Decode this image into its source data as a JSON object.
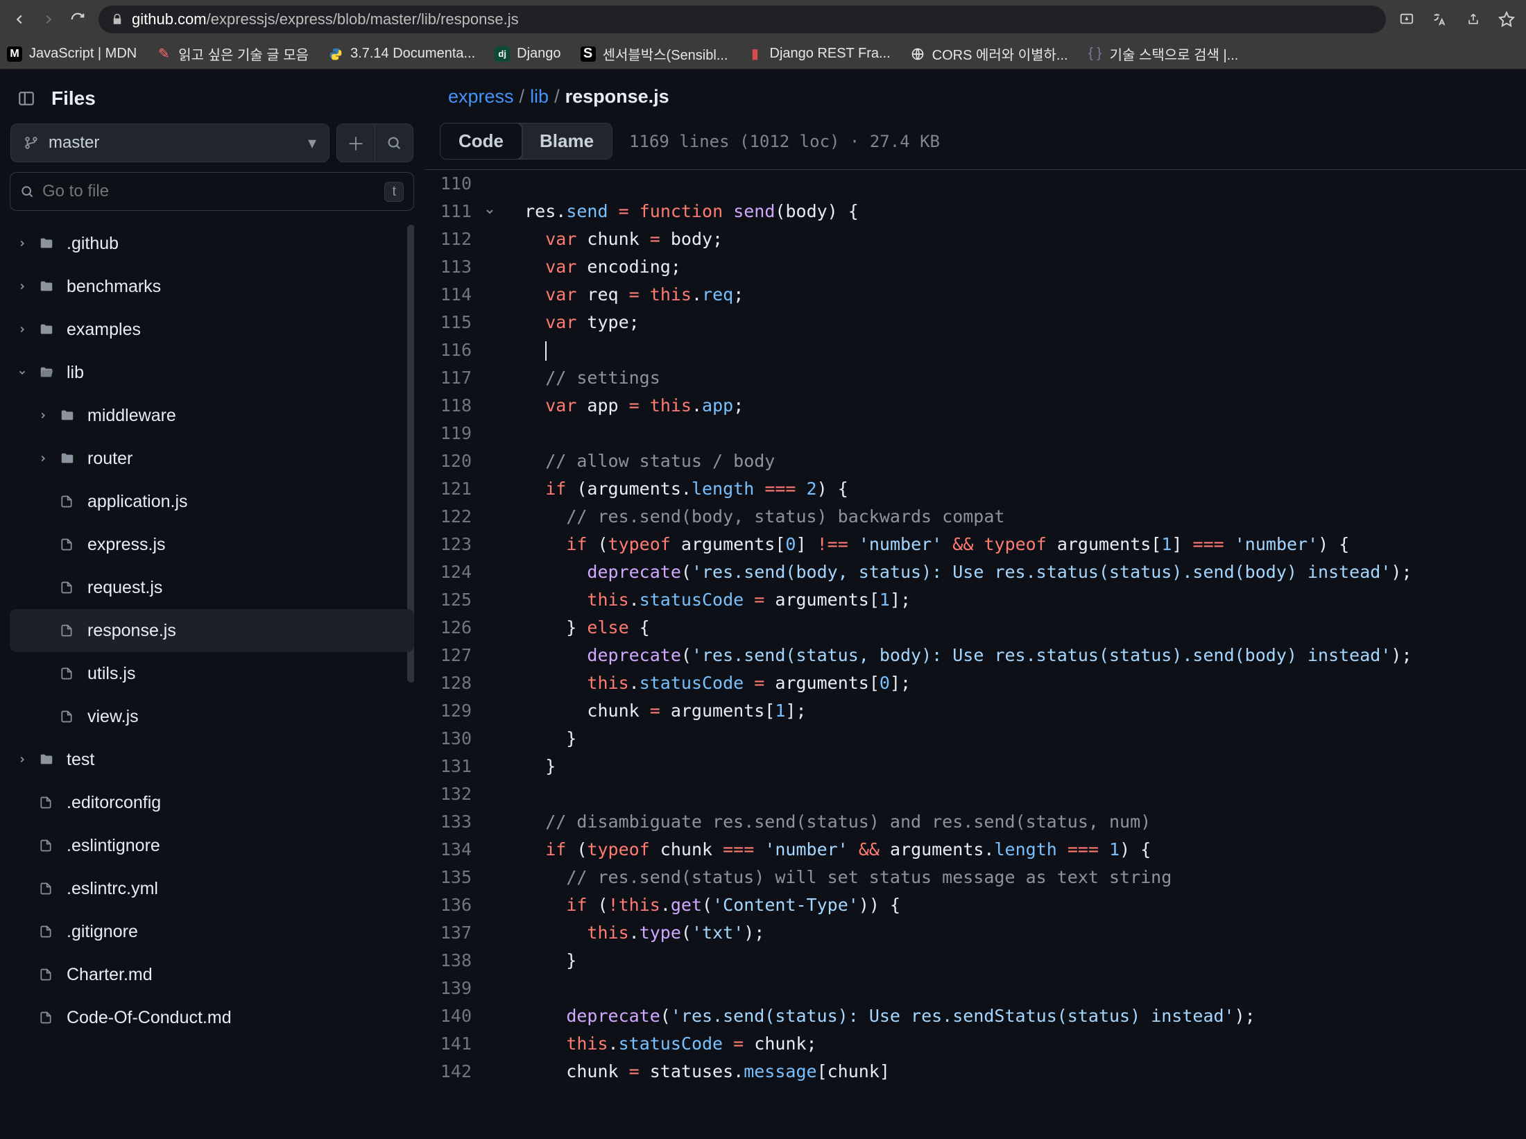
{
  "browser": {
    "url_host": "github.com",
    "url_path": "/expressjs/express/blob/master/lib/response.js"
  },
  "bookmarks": [
    {
      "label": "JavaScript | MDN"
    },
    {
      "label": "읽고 싶은 기술 글 모음"
    },
    {
      "label": "3.7.14 Documenta..."
    },
    {
      "label": "Django"
    },
    {
      "label": "센서블박스(Sensibl..."
    },
    {
      "label": "Django REST Fra..."
    },
    {
      "label": "CORS 에러와 이별하..."
    },
    {
      "label": "기술 스택으로 검색 |..."
    }
  ],
  "sidebar": {
    "title": "Files",
    "branch": "master",
    "search_placeholder": "Go to file",
    "kbd": "t"
  },
  "tree": [
    {
      "name": ".github",
      "type": "dir",
      "depth": 0,
      "expanded": false
    },
    {
      "name": "benchmarks",
      "type": "dir",
      "depth": 0,
      "expanded": false
    },
    {
      "name": "examples",
      "type": "dir",
      "depth": 0,
      "expanded": false
    },
    {
      "name": "lib",
      "type": "dir",
      "depth": 0,
      "expanded": true
    },
    {
      "name": "middleware",
      "type": "dir",
      "depth": 1,
      "expanded": false
    },
    {
      "name": "router",
      "type": "dir",
      "depth": 1,
      "expanded": false
    },
    {
      "name": "application.js",
      "type": "file",
      "depth": 1
    },
    {
      "name": "express.js",
      "type": "file",
      "depth": 1
    },
    {
      "name": "request.js",
      "type": "file",
      "depth": 1
    },
    {
      "name": "response.js",
      "type": "file",
      "depth": 1,
      "selected": true
    },
    {
      "name": "utils.js",
      "type": "file",
      "depth": 1
    },
    {
      "name": "view.js",
      "type": "file",
      "depth": 1
    },
    {
      "name": "test",
      "type": "dir",
      "depth": 0,
      "expanded": false
    },
    {
      "name": ".editorconfig",
      "type": "file",
      "depth": 0
    },
    {
      "name": ".eslintignore",
      "type": "file",
      "depth": 0
    },
    {
      "name": ".eslintrc.yml",
      "type": "file",
      "depth": 0
    },
    {
      "name": ".gitignore",
      "type": "file",
      "depth": 0
    },
    {
      "name": "Charter.md",
      "type": "file",
      "depth": 0
    },
    {
      "name": "Code-Of-Conduct.md",
      "type": "file",
      "depth": 0
    }
  ],
  "breadcrumb": {
    "repo": "express",
    "path": "lib",
    "file": "response.js"
  },
  "tabs": {
    "code": "Code",
    "blame": "Blame"
  },
  "meta": "1169 lines (1012 loc) · 27.4 KB",
  "code": [
    {
      "n": 110,
      "t": [
        [
          "plain",
          ""
        ]
      ]
    },
    {
      "n": 111,
      "fold": true,
      "t": [
        [
          "plain",
          "  res."
        ],
        [
          "prop",
          "send"
        ],
        [
          "plain",
          " "
        ],
        [
          "op",
          "="
        ],
        [
          "plain",
          " "
        ],
        [
          "key",
          "function"
        ],
        [
          "plain",
          " "
        ],
        [
          "func",
          "send"
        ],
        [
          "plain",
          "(body) {"
        ]
      ]
    },
    {
      "n": 112,
      "t": [
        [
          "plain",
          "    "
        ],
        [
          "key",
          "var"
        ],
        [
          "plain",
          " chunk "
        ],
        [
          "op",
          "="
        ],
        [
          "plain",
          " body;"
        ]
      ]
    },
    {
      "n": 113,
      "t": [
        [
          "plain",
          "    "
        ],
        [
          "key",
          "var"
        ],
        [
          "plain",
          " encoding;"
        ]
      ]
    },
    {
      "n": 114,
      "t": [
        [
          "plain",
          "    "
        ],
        [
          "key",
          "var"
        ],
        [
          "plain",
          " req "
        ],
        [
          "op",
          "="
        ],
        [
          "plain",
          " "
        ],
        [
          "key",
          "this"
        ],
        [
          "plain",
          "."
        ],
        [
          "prop",
          "req"
        ],
        [
          "plain",
          ";"
        ]
      ]
    },
    {
      "n": 115,
      "t": [
        [
          "plain",
          "    "
        ],
        [
          "key",
          "var"
        ],
        [
          "plain",
          " type;"
        ]
      ]
    },
    {
      "n": 116,
      "t": [
        [
          "plain",
          "    "
        ],
        [
          "caret",
          ""
        ]
      ]
    },
    {
      "n": 117,
      "t": [
        [
          "plain",
          "    "
        ],
        [
          "com",
          "// settings"
        ]
      ]
    },
    {
      "n": 118,
      "t": [
        [
          "plain",
          "    "
        ],
        [
          "key",
          "var"
        ],
        [
          "plain",
          " app "
        ],
        [
          "op",
          "="
        ],
        [
          "plain",
          " "
        ],
        [
          "key",
          "this"
        ],
        [
          "plain",
          "."
        ],
        [
          "prop",
          "app"
        ],
        [
          "plain",
          ";"
        ]
      ]
    },
    {
      "n": 119,
      "t": [
        [
          "plain",
          ""
        ]
      ]
    },
    {
      "n": 120,
      "t": [
        [
          "plain",
          "    "
        ],
        [
          "com",
          "// allow status / body"
        ]
      ]
    },
    {
      "n": 121,
      "t": [
        [
          "plain",
          "    "
        ],
        [
          "key",
          "if"
        ],
        [
          "plain",
          " (arguments."
        ],
        [
          "prop",
          "length"
        ],
        [
          "plain",
          " "
        ],
        [
          "op",
          "==="
        ],
        [
          "plain",
          " "
        ],
        [
          "num",
          "2"
        ],
        [
          "plain",
          ") {"
        ]
      ]
    },
    {
      "n": 122,
      "t": [
        [
          "plain",
          "      "
        ],
        [
          "com",
          "// res.send(body, status) backwards compat"
        ]
      ]
    },
    {
      "n": 123,
      "t": [
        [
          "plain",
          "      "
        ],
        [
          "key",
          "if"
        ],
        [
          "plain",
          " ("
        ],
        [
          "key",
          "typeof"
        ],
        [
          "plain",
          " arguments["
        ],
        [
          "num",
          "0"
        ],
        [
          "plain",
          "] "
        ],
        [
          "op",
          "!=="
        ],
        [
          "plain",
          " "
        ],
        [
          "str",
          "'number'"
        ],
        [
          "plain",
          " "
        ],
        [
          "op",
          "&&"
        ],
        [
          "plain",
          " "
        ],
        [
          "key",
          "typeof"
        ],
        [
          "plain",
          " arguments["
        ],
        [
          "num",
          "1"
        ],
        [
          "plain",
          "] "
        ],
        [
          "op",
          "==="
        ],
        [
          "plain",
          " "
        ],
        [
          "str",
          "'number'"
        ],
        [
          "plain",
          ") {"
        ]
      ]
    },
    {
      "n": 124,
      "t": [
        [
          "plain",
          "        "
        ],
        [
          "func",
          "deprecate"
        ],
        [
          "plain",
          "("
        ],
        [
          "str",
          "'res.send(body, status): Use res.status(status).send(body) instead'"
        ],
        [
          "plain",
          ");"
        ]
      ]
    },
    {
      "n": 125,
      "t": [
        [
          "plain",
          "        "
        ],
        [
          "key",
          "this"
        ],
        [
          "plain",
          "."
        ],
        [
          "prop",
          "statusCode"
        ],
        [
          "plain",
          " "
        ],
        [
          "op",
          "="
        ],
        [
          "plain",
          " arguments["
        ],
        [
          "num",
          "1"
        ],
        [
          "plain",
          "];"
        ]
      ]
    },
    {
      "n": 126,
      "t": [
        [
          "plain",
          "      } "
        ],
        [
          "key",
          "else"
        ],
        [
          "plain",
          " {"
        ]
      ]
    },
    {
      "n": 127,
      "t": [
        [
          "plain",
          "        "
        ],
        [
          "func",
          "deprecate"
        ],
        [
          "plain",
          "("
        ],
        [
          "str",
          "'res.send(status, body): Use res.status(status).send(body) instead'"
        ],
        [
          "plain",
          ");"
        ]
      ]
    },
    {
      "n": 128,
      "t": [
        [
          "plain",
          "        "
        ],
        [
          "key",
          "this"
        ],
        [
          "plain",
          "."
        ],
        [
          "prop",
          "statusCode"
        ],
        [
          "plain",
          " "
        ],
        [
          "op",
          "="
        ],
        [
          "plain",
          " arguments["
        ],
        [
          "num",
          "0"
        ],
        [
          "plain",
          "];"
        ]
      ]
    },
    {
      "n": 129,
      "t": [
        [
          "plain",
          "        chunk "
        ],
        [
          "op",
          "="
        ],
        [
          "plain",
          " arguments["
        ],
        [
          "num",
          "1"
        ],
        [
          "plain",
          "];"
        ]
      ]
    },
    {
      "n": 130,
      "t": [
        [
          "plain",
          "      }"
        ]
      ]
    },
    {
      "n": 131,
      "t": [
        [
          "plain",
          "    }"
        ]
      ]
    },
    {
      "n": 132,
      "t": [
        [
          "plain",
          ""
        ]
      ]
    },
    {
      "n": 133,
      "t": [
        [
          "plain",
          "    "
        ],
        [
          "com",
          "// disambiguate res.send(status) and res.send(status, num)"
        ]
      ]
    },
    {
      "n": 134,
      "t": [
        [
          "plain",
          "    "
        ],
        [
          "key",
          "if"
        ],
        [
          "plain",
          " ("
        ],
        [
          "key",
          "typeof"
        ],
        [
          "plain",
          " chunk "
        ],
        [
          "op",
          "==="
        ],
        [
          "plain",
          " "
        ],
        [
          "str",
          "'number'"
        ],
        [
          "plain",
          " "
        ],
        [
          "op",
          "&&"
        ],
        [
          "plain",
          " arguments."
        ],
        [
          "prop",
          "length"
        ],
        [
          "plain",
          " "
        ],
        [
          "op",
          "==="
        ],
        [
          "plain",
          " "
        ],
        [
          "num",
          "1"
        ],
        [
          "plain",
          ") {"
        ]
      ]
    },
    {
      "n": 135,
      "t": [
        [
          "plain",
          "      "
        ],
        [
          "com",
          "// res.send(status) will set status message as text string"
        ]
      ]
    },
    {
      "n": 136,
      "t": [
        [
          "plain",
          "      "
        ],
        [
          "key",
          "if"
        ],
        [
          "plain",
          " ("
        ],
        [
          "op",
          "!"
        ],
        [
          "key",
          "this"
        ],
        [
          "plain",
          "."
        ],
        [
          "func",
          "get"
        ],
        [
          "plain",
          "("
        ],
        [
          "str",
          "'Content-Type'"
        ],
        [
          "plain",
          ")) {"
        ]
      ]
    },
    {
      "n": 137,
      "t": [
        [
          "plain",
          "        "
        ],
        [
          "key",
          "this"
        ],
        [
          "plain",
          "."
        ],
        [
          "func",
          "type"
        ],
        [
          "plain",
          "("
        ],
        [
          "str",
          "'txt'"
        ],
        [
          "plain",
          ");"
        ]
      ]
    },
    {
      "n": 138,
      "t": [
        [
          "plain",
          "      }"
        ]
      ]
    },
    {
      "n": 139,
      "t": [
        [
          "plain",
          ""
        ]
      ]
    },
    {
      "n": 140,
      "t": [
        [
          "plain",
          "      "
        ],
        [
          "func",
          "deprecate"
        ],
        [
          "plain",
          "("
        ],
        [
          "str",
          "'res.send(status): Use res.sendStatus(status) instead'"
        ],
        [
          "plain",
          ");"
        ]
      ]
    },
    {
      "n": 141,
      "t": [
        [
          "plain",
          "      "
        ],
        [
          "key",
          "this"
        ],
        [
          "plain",
          "."
        ],
        [
          "prop",
          "statusCode"
        ],
        [
          "plain",
          " "
        ],
        [
          "op",
          "="
        ],
        [
          "plain",
          " chunk;"
        ]
      ]
    },
    {
      "n": 142,
      "t": [
        [
          "plain",
          "      chunk "
        ],
        [
          "op",
          "="
        ],
        [
          "plain",
          " statuses."
        ],
        [
          "prop",
          "message"
        ],
        [
          "plain",
          "[chunk]"
        ]
      ]
    }
  ]
}
